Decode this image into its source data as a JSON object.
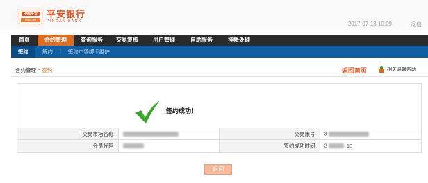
{
  "bank": {
    "logo_badge_top": "中国平安",
    "logo_badge_bottom": "PING AN",
    "name_cn": "平安银行",
    "name_en": "PINGAN BANK"
  },
  "header": {
    "datetime": "2017-07-13  10:09",
    "logout": "退出"
  },
  "nav": {
    "items": [
      {
        "label": "首页",
        "active": false
      },
      {
        "label": "合约管理",
        "active": true
      },
      {
        "label": "查询服务",
        "active": false
      },
      {
        "label": "交易复核",
        "active": false
      },
      {
        "label": "用户管理",
        "active": false
      },
      {
        "label": "自助服务",
        "active": false
      },
      {
        "label": "挂帐处理",
        "active": false
      }
    ]
  },
  "subnav": {
    "items": [
      {
        "label": "签约",
        "active": true
      },
      {
        "label": "解约",
        "active": false
      },
      {
        "label": "签约市场绑卡维护",
        "active": false
      }
    ]
  },
  "breadcrumb": {
    "parent": "合约管理",
    "separator": ">",
    "current": "签约"
  },
  "actions": {
    "back_home": "返回首页",
    "help": "相关温馨帮助"
  },
  "result": {
    "message": "签约成功！"
  },
  "info": {
    "market_name_label": "交易市场名称",
    "market_name_value": "",
    "account_label": "交易账号",
    "account_value": "3",
    "member_code_label": "会员代码",
    "member_code_value": "",
    "sign_time_label": "签约成功时间",
    "sign_time_value_prefix": "2",
    "sign_time_value_suffix": "13"
  },
  "buttons": {
    "return": "返 回"
  },
  "colors": {
    "brand": "#e5501c",
    "nav_bg": "#2b2b2b",
    "nav_active": "#e26c1e",
    "subnav_bg": "#0f5fa2",
    "success_check": "#3aa52d"
  },
  "icons": {
    "success": "check-icon",
    "help": "plant-pot-icon"
  }
}
